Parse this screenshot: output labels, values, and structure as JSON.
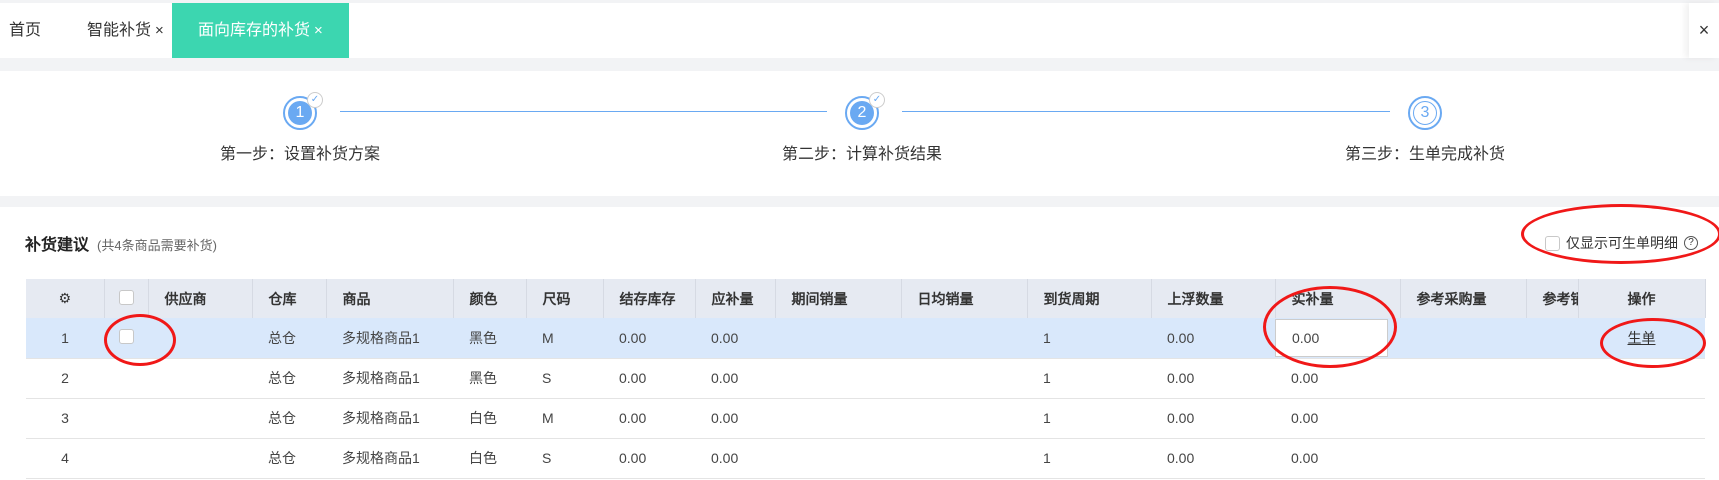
{
  "tabs": {
    "home": "首页",
    "smart": "智能补货",
    "active": "面向库存的补货",
    "close": "×"
  },
  "steps": [
    {
      "num": "1",
      "label": "第一步：设置补货方案",
      "done": true
    },
    {
      "num": "2",
      "label": "第二步：计算补货结果",
      "done": true
    },
    {
      "num": "3",
      "label": "第三步：生单完成补货",
      "done": false
    }
  ],
  "section": {
    "title": "补货建议",
    "subtitle": "(共4条商品需要补货)",
    "only_show_label": "仅显示可生单明细",
    "help": "?"
  },
  "table": {
    "headers": [
      "供应商",
      "仓库",
      "商品",
      "颜色",
      "尺码",
      "结存库存",
      "应补量",
      "期间销量",
      "日均销量",
      "到货周期",
      "上浮数量",
      "实补量",
      "参考采购量",
      "参考销",
      "操作"
    ],
    "rows": [
      {
        "no": "1",
        "supplier": "",
        "wh": "总仓",
        "item": "多规格商品1",
        "color": "黑色",
        "size": "M",
        "stock": "0.00",
        "should": "0.00",
        "period": "",
        "daily": "",
        "cycle": "1",
        "float": "0.00",
        "actual": "0.00",
        "ref": "",
        "ref2": "",
        "op": "生单"
      },
      {
        "no": "2",
        "supplier": "",
        "wh": "总仓",
        "item": "多规格商品1",
        "color": "黑色",
        "size": "S",
        "stock": "0.00",
        "should": "0.00",
        "period": "",
        "daily": "",
        "cycle": "1",
        "float": "0.00",
        "actual": "0.00",
        "ref": "",
        "ref2": "",
        "op": ""
      },
      {
        "no": "3",
        "supplier": "",
        "wh": "总仓",
        "item": "多规格商品1",
        "color": "白色",
        "size": "M",
        "stock": "0.00",
        "should": "0.00",
        "period": "",
        "daily": "",
        "cycle": "1",
        "float": "0.00",
        "actual": "0.00",
        "ref": "",
        "ref2": "",
        "op": ""
      },
      {
        "no": "4",
        "supplier": "",
        "wh": "总仓",
        "item": "多规格商品1",
        "color": "白色",
        "size": "S",
        "stock": "0.00",
        "should": "0.00",
        "period": "",
        "daily": "",
        "cycle": "1",
        "float": "0.00",
        "actual": "0.00",
        "ref": "",
        "ref2": "",
        "op": ""
      }
    ]
  },
  "colors": {
    "accent": "#3cd6b0",
    "step": "#6aa9f2",
    "selected_row": "#d9e8fb",
    "annotation": "#f01818"
  }
}
